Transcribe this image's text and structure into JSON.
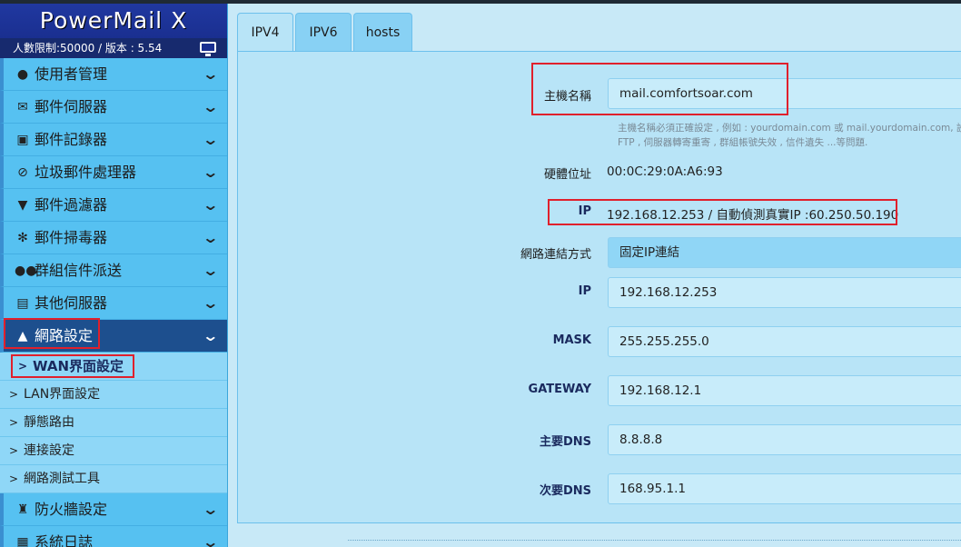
{
  "app": {
    "title": "PowerMail X",
    "license_info": "人數限制:50000 / 版本 : 5.54"
  },
  "sidebar": {
    "items": [
      {
        "label": "使用者管理",
        "icon": "user-icon"
      },
      {
        "label": "郵件伺服器",
        "icon": "envelope-icon"
      },
      {
        "label": "郵件記錄器",
        "icon": "camera-icon"
      },
      {
        "label": "垃圾郵件處理器",
        "icon": "ban-icon"
      },
      {
        "label": "郵件過濾器",
        "icon": "filter-icon"
      },
      {
        "label": "郵件掃毒器",
        "icon": "bug-icon"
      },
      {
        "label": "群組信件派送",
        "icon": "users-icon"
      },
      {
        "label": "其他伺服器",
        "icon": "server-icon"
      },
      {
        "label": "網路設定",
        "icon": "sitemap-icon",
        "active": true
      },
      {
        "label": "防火牆設定",
        "icon": "castle-icon"
      },
      {
        "label": "系統日誌",
        "icon": "film-icon"
      }
    ],
    "network_sub": [
      "WAN界面設定",
      "LAN界面設定",
      "靜態路由",
      "連接設定",
      "網路測試工具"
    ]
  },
  "tabs": [
    "IPV4",
    "IPV6",
    "hosts"
  ],
  "form": {
    "hostname_label": "主機名稱",
    "hostname_value": "mail.comfortsoar.com",
    "hostname_hint_1": "主機名稱必須正確設定 , 例如 : yourdomain.com 或 mail.yourdomain.com, 設",
    "hostname_hint_2": "FTP , 伺服器轉寄重寄 , 群組帳號失效 , 信件遺失 ...等問題.",
    "mac_label": "硬體位址",
    "mac_value": "00:0C:29:0A:A6:93",
    "ip_info_label": "IP",
    "ip_info_value": "192.168.12.253 / 自動偵測真實IP :60.250.50.190",
    "conn_label": "網路連結方式",
    "conn_value": "固定IP連結",
    "ip_label": "IP",
    "ip_value": "192.168.12.253",
    "mask_label": "MASK",
    "mask_value": "255.255.255.0",
    "gateway_label": "GATEWAY",
    "gateway_value": "192.168.12.1",
    "dns1_label": "主要DNS",
    "dns1_value": "8.8.8.8",
    "dns2_label": "次要DNS",
    "dns2_value": "168.95.1.1"
  },
  "colors": {
    "sidebar_bg": "#56c1f1",
    "brand_bg": "#1a2f90",
    "active_item": "#1d4f8e",
    "highlight_border": "#e0202c",
    "panel_bg": "#b8e4f7"
  }
}
